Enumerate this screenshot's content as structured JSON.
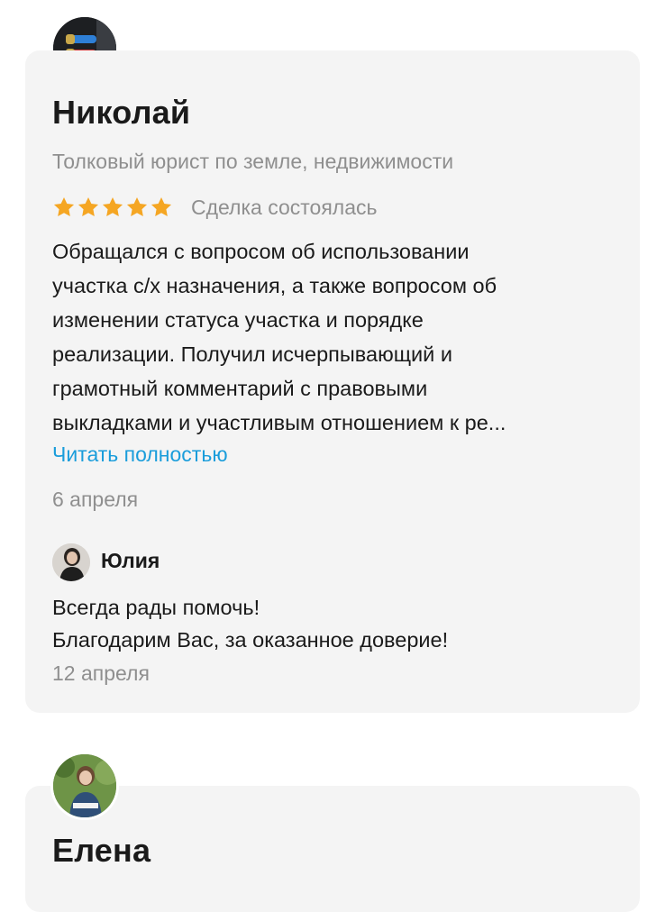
{
  "reviews": [
    {
      "author": "Николай",
      "subtitle": "Толковый юрист по земле, недвижимости",
      "rating": 5,
      "deal_status": "Сделка состоялась",
      "text_lines": [
        "Обращался с вопросом об использовании",
        "участка с/х назначения, а также вопросом об",
        "изменении статуса участка и порядке",
        "реализации. Получил исчерпывающий и",
        "грамотный комментарий с правовыми",
        "выкладками и участливым отношением к ре..."
      ],
      "read_more": "Читать полностью",
      "date": "6 апреля",
      "reply": {
        "author": "Юлия",
        "text_lines": [
          "Всегда рады помочь!",
          "Благодарим Вас, за оказанное доверие!"
        ],
        "date": "12 апреля"
      }
    },
    {
      "author": "Елена"
    }
  ],
  "colors": {
    "card_bg": "#f4f4f4",
    "star": "#f5a623",
    "link": "#1a9ddb",
    "muted": "#8f8f8f"
  },
  "icons": [
    "star-icon"
  ]
}
